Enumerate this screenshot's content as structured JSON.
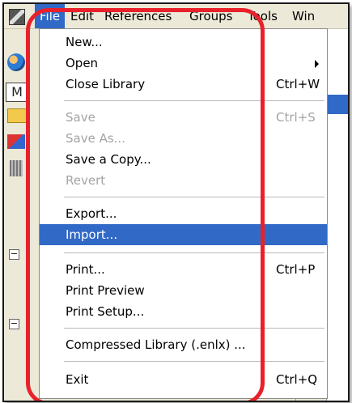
{
  "menubar": {
    "items": [
      "File",
      "Edit",
      "References",
      "Groups",
      "Tools",
      "Win"
    ]
  },
  "left_toolbar": {
    "view_glyph": "M",
    "collapse_glyph": "−"
  },
  "file_menu": {
    "items": [
      {
        "label": "New...",
        "shortcut": "",
        "enabled": true
      },
      {
        "label": "Open",
        "shortcut": "",
        "enabled": true,
        "submenu": true
      },
      {
        "label": "Close Library",
        "shortcut": "Ctrl+W",
        "enabled": true
      },
      {
        "label": "Save",
        "shortcut": "Ctrl+S",
        "enabled": false
      },
      {
        "label": "Save As...",
        "shortcut": "",
        "enabled": false
      },
      {
        "label": "Save a Copy...",
        "shortcut": "",
        "enabled": true
      },
      {
        "label": "Revert",
        "shortcut": "",
        "enabled": false
      },
      {
        "label": "Export...",
        "shortcut": "",
        "enabled": true
      },
      {
        "label": "Import...",
        "shortcut": "",
        "enabled": true,
        "highlighted": true
      },
      {
        "label": "Print...",
        "shortcut": "Ctrl+P",
        "enabled": true
      },
      {
        "label": "Print Preview",
        "shortcut": "",
        "enabled": true
      },
      {
        "label": "Print Setup...",
        "shortcut": "",
        "enabled": true
      },
      {
        "label": "Compressed Library (.enlx) ...",
        "shortcut": "",
        "enabled": true
      },
      {
        "label": "Exit",
        "shortcut": "Ctrl+Q",
        "enabled": true
      }
    ]
  },
  "colors": {
    "highlight": "#3169c6",
    "annotation": "#e8212b",
    "disabled_text": "#a4a4a4"
  }
}
